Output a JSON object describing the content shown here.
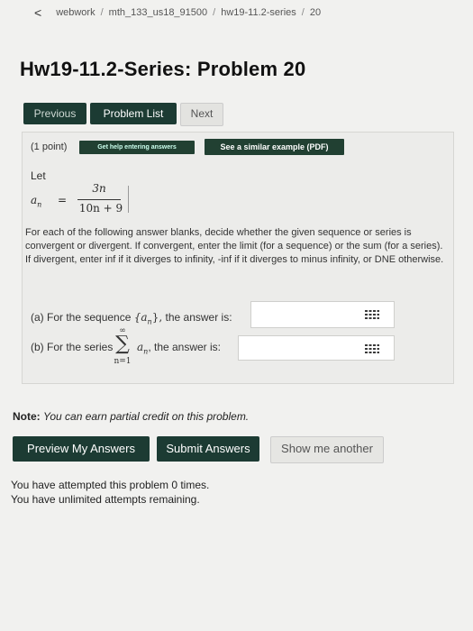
{
  "breadcrumb": {
    "back": "<",
    "items": [
      "webwork",
      "mth_133_us18_91500",
      "hw19-11.2-series",
      "20"
    ],
    "separator": "/"
  },
  "title": "Hw19-11.2-Series: Problem 20",
  "nav": {
    "previous": "Previous",
    "problem_list": "Problem List",
    "next": "Next"
  },
  "problem": {
    "points": "(1 point)",
    "help_button": "Get help entering answers",
    "similar_button": "See a similar example (PDF)",
    "let": "Let",
    "an": "a",
    "an_sub": "n",
    "equals": "=",
    "numerator": "3n",
    "denominator": "10n + 9",
    "paragraph": "For each of the following answer blanks, decide whether the given sequence or series is convergent or divergent. If convergent, enter the limit (for a sequence) or the sum (for a series). If divergent, enter inf if it diverges to infinity, -inf if it diverges to minus infinity, or DNE otherwise.",
    "qa_prefix": "(a) For the sequence",
    "qa_seq": "{a",
    "qa_seq_sub": "n",
    "qa_seq_end": "},",
    "qa_suffix": "the answer is:",
    "qb_prefix": "(b) For the series",
    "qb_sigma_top": "∞",
    "qb_sigma": "∑",
    "qb_sigma_bottom": "n=1",
    "qb_term": "a",
    "qb_term_sub": "n",
    "qb_suffix": ", the answer is:",
    "answer_a": "",
    "answer_b": ""
  },
  "note": {
    "label": "Note:",
    "text": "You can earn partial credit on this problem."
  },
  "buttons": {
    "preview": "Preview My Answers",
    "submit": "Submit Answers",
    "another": "Show me another"
  },
  "attempts": {
    "line1": "You have attempted this problem 0 times.",
    "line2": "You have unlimited attempts remaining."
  }
}
